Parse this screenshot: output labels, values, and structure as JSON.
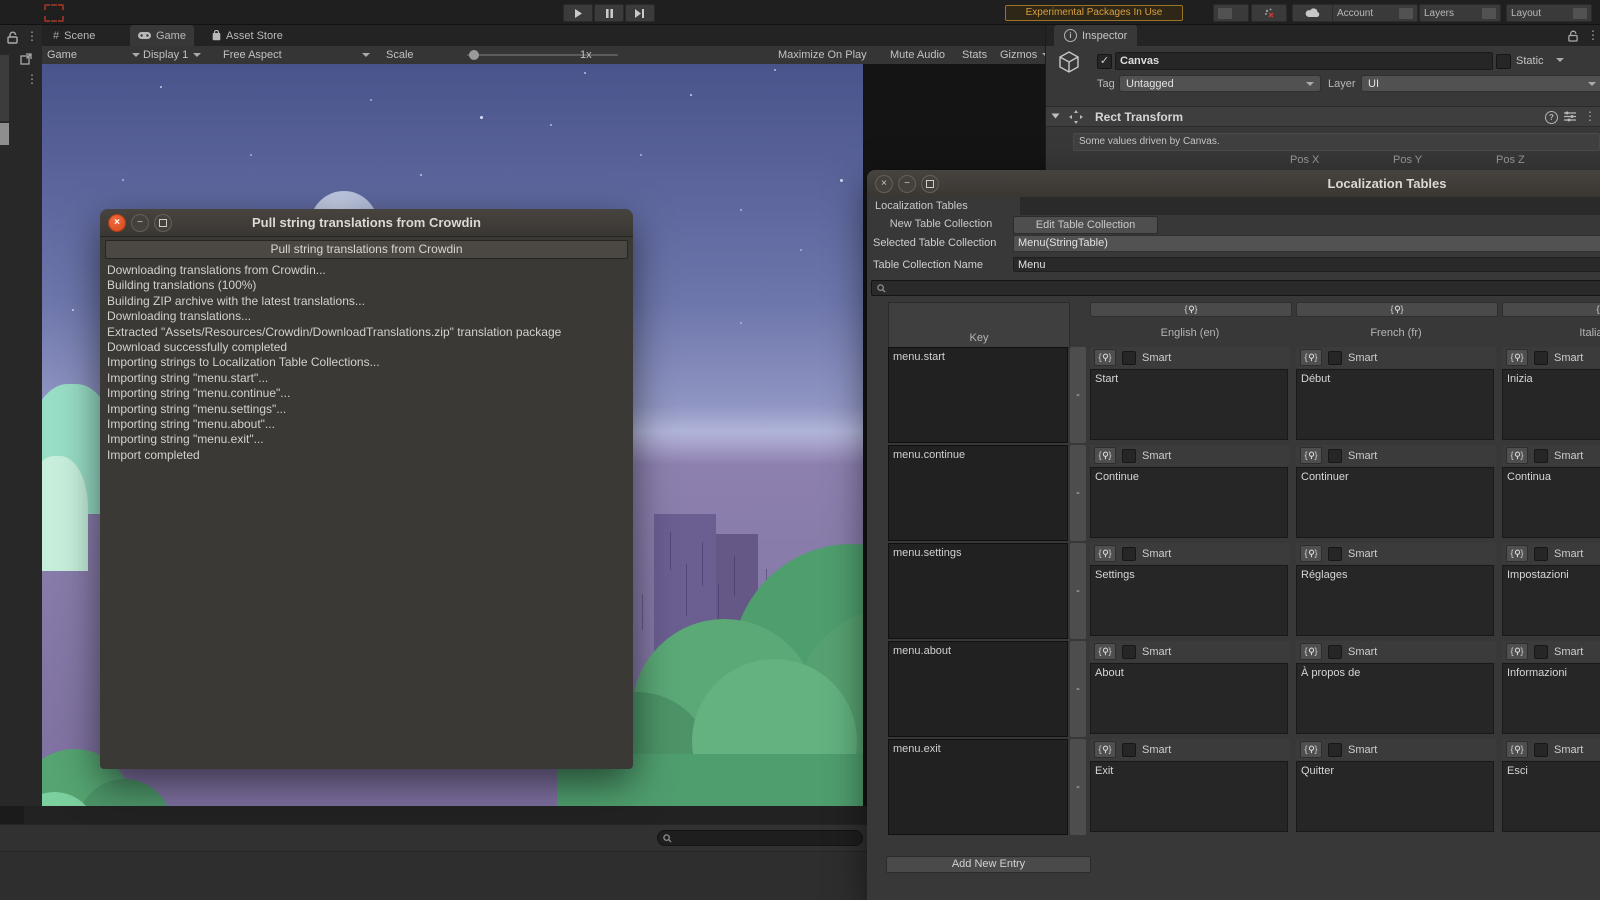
{
  "editor": {
    "top_bar": {
      "experimental_warning": "Experimental Packages In Use",
      "account_label": "Account",
      "layers_label": "Layers",
      "layout_label": "Layout"
    },
    "view_tabs": {
      "scene": "Scene",
      "game": "Game",
      "asset_store": "Asset Store"
    },
    "game_toolbar": {
      "game_dropdown": "Game",
      "display_dropdown": "Display 1",
      "aspect_dropdown": "Free Aspect",
      "scale_label": "Scale",
      "scale_value": "1x",
      "maximize_label": "Maximize On Play",
      "mute_label": "Mute Audio",
      "stats_label": "Stats",
      "gizmos_label": "Gizmos"
    },
    "inspector": {
      "tab_label": "Inspector",
      "object_name": "Canvas",
      "static_label": "Static",
      "tag_label": "Tag",
      "tag_value": "Untagged",
      "layer_label": "Layer",
      "layer_value": "UI",
      "component_title": "Rect Transform",
      "info_message": "Some values driven by Canvas.",
      "pos_labels": [
        "Pos X",
        "Pos Y",
        "Pos Z"
      ]
    }
  },
  "crowdin_dialog": {
    "title": "Pull string translations from Crowdin",
    "action_button": "Pull string translations from Crowdin",
    "log_lines": [
      "Downloading translations from Crowdin...",
      "Building translations (100%)",
      "Building ZIP archive with the latest translations...",
      "Downloading translations...",
      "Extracted \"Assets/Resources/Crowdin/DownloadTranslations.zip\" translation package",
      "Download successfully completed",
      "Importing strings to Localization Table Collections...",
      "Importing string \"menu.start\"...",
      "Importing string \"menu.continue\"...",
      "Importing string \"menu.settings\"...",
      "Importing string \"menu.about\"...",
      "Importing string \"menu.exit\"...",
      "Import completed"
    ]
  },
  "loc_window": {
    "title": "Localization Tables",
    "tab_label": "Localization Tables",
    "new_button": "New Table Collection",
    "edit_button": "Edit Table Collection",
    "selected_label": "Selected Table Collection",
    "selected_value": "Menu(StringTable)",
    "name_label": "Table Collection Name",
    "name_value": "Menu",
    "table": {
      "key_header": "Key",
      "language_headers": [
        "English (en)",
        "French (fr)",
        "Italian (it)"
      ],
      "smart_label": "Smart",
      "remove_label": "-",
      "add_button": "Add New Entry",
      "rows": [
        {
          "key": "menu.start",
          "values": [
            "Start",
            "Début",
            "Inizia"
          ]
        },
        {
          "key": "menu.continue",
          "values": [
            "Continue",
            "Continuer",
            "Continua"
          ]
        },
        {
          "key": "menu.settings",
          "values": [
            "Settings",
            "Réglages",
            "Impostazioni"
          ]
        },
        {
          "key": "menu.about",
          "values": [
            "About",
            "À propos de",
            "Informazioni"
          ]
        },
        {
          "key": "menu.exit",
          "values": [
            "Exit",
            "Quitter",
            "Esci"
          ]
        }
      ]
    }
  },
  "colors": {
    "accent_warning": "#d89f3e",
    "close_button": "#e0551f",
    "unity_panel": "#383838",
    "scene_sky_top": "#49548c",
    "scene_ground": "#867aa8",
    "scene_bush": "#55a471"
  }
}
